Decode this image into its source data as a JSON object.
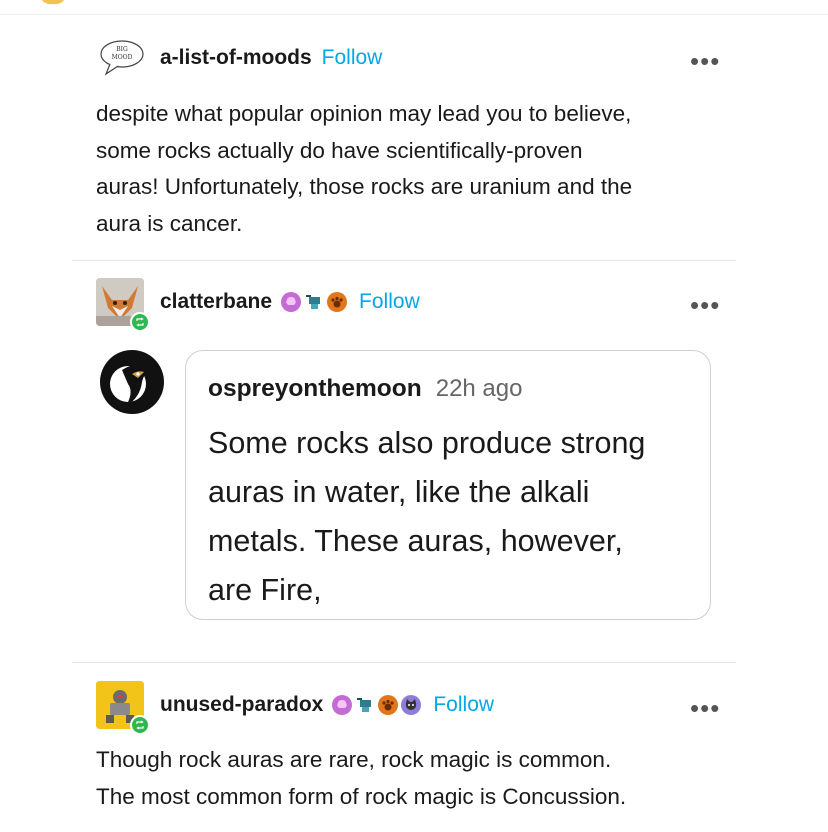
{
  "post1": {
    "username": "a-list-of-moods",
    "follow_label": "Follow",
    "avatar_text": "BIG MOOD",
    "more_label": "•••",
    "body": [
      "despite what popular opinion may lead you to believe,",
      "some rocks actually do have scientifically-proven",
      "auras! Unfortunately, those rocks are uranium and the",
      "aura is cancer."
    ]
  },
  "post2": {
    "username": "clatterbane",
    "follow_label": "Follow",
    "more_label": "•••",
    "badges": [
      "brain-badge-icon",
      "robot-badge-icon",
      "paw-badge-icon"
    ],
    "ask": {
      "username": "ospreyonthemoon",
      "time": "22h ago",
      "text": [
        "Some rocks also produce strong",
        "auras in water, like the alkali",
        "metals. These auras, however,",
        "are Fire,"
      ]
    }
  },
  "post3": {
    "username": "unused-paradox",
    "follow_label": "Follow",
    "more_label": "•••",
    "badges": [
      "brain-badge-icon",
      "robot-badge-icon",
      "paw-badge-icon",
      "cat-badge-icon"
    ],
    "body": [
      "Though rock auras are rare, rock magic is common.",
      "The most common form of rock magic is Concussion."
    ]
  },
  "colors": {
    "follow": "#00a8e6",
    "reblog_badge": "#2fb84f",
    "divider": "#e6e6e6",
    "brain_badge": "#c46bd6",
    "paw_badge": "#e2761b"
  }
}
